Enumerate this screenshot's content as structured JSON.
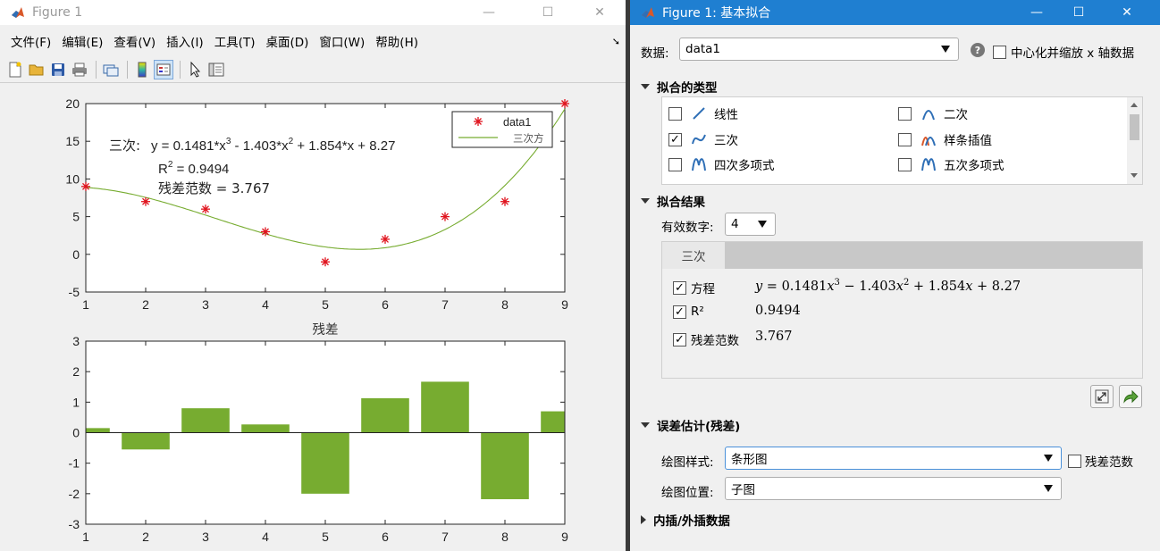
{
  "figure_window": {
    "title": "Figure 1",
    "menu": [
      "文件(F)",
      "编辑(E)",
      "查看(V)",
      "插入(I)",
      "工具(T)",
      "桌面(D)",
      "窗口(W)",
      "帮助(H)"
    ],
    "toolbar_icons": [
      "new-figure-icon",
      "open-icon",
      "save-icon",
      "print-icon",
      "link-icon",
      "colorbar-icon",
      "legend-icon",
      "pointer-icon",
      "property-editor-icon"
    ]
  },
  "fit_window": {
    "title": "Figure 1: 基本拟合",
    "data_label": "数据:",
    "data_value": "data1",
    "center_label": "中心化并缩放 x 轴数据",
    "section_fit_types": "拟合的类型",
    "fit_types": [
      {
        "label": "线性",
        "checked": false
      },
      {
        "label": "二次",
        "checked": false
      },
      {
        "label": "三次",
        "checked": true
      },
      {
        "label": "样条插值",
        "checked": false
      },
      {
        "label": "四次多项式",
        "checked": false
      },
      {
        "label": "五次多项式",
        "checked": false
      }
    ],
    "section_results": "拟合结果",
    "sig_digits_label": "有效数字:",
    "sig_digits_value": "4",
    "result_tab": "三次",
    "equation_label": "方程",
    "r2_label": "R²",
    "r2_value": "0.9494",
    "norm_label": "残差范数",
    "norm_value": "3.767",
    "section_error": "误差估计(残差)",
    "plot_style_label": "绘图样式:",
    "plot_style_value": "条形图",
    "resid_norm_check": "残差范数",
    "plot_location_label": "绘图位置:",
    "plot_location_value": "子图",
    "section_interp": "内插/外插数据"
  },
  "chart_data": [
    {
      "type": "scatter",
      "x": [
        1,
        2,
        3,
        4,
        5,
        6,
        7,
        8,
        9
      ],
      "y": [
        9,
        7,
        6,
        3,
        -1,
        2,
        5,
        7,
        20
      ],
      "xlim": [
        1,
        9
      ],
      "ylim": [
        -5,
        20
      ],
      "xticks": [
        1,
        2,
        3,
        4,
        5,
        6,
        7,
        8,
        9
      ],
      "yticks": [
        -5,
        0,
        5,
        10,
        15,
        20
      ],
      "fit": {
        "name": "三次方",
        "coefficients": [
          0.1481,
          -1.403,
          1.854,
          8.27
        ]
      },
      "legend": {
        "placement": "top-right",
        "entries": [
          "data1",
          "三次方"
        ]
      },
      "marker_color": "#e0141e",
      "fit_color": "#77ac30",
      "annotation": {
        "prefix": "三次:",
        "equation": "y = 0.1481*x³ - 1.403*x² + 1.854*x + 8.27",
        "r2": "R² = 0.9494",
        "norm": "残差范数 = 3.767"
      }
    },
    {
      "type": "bar",
      "title": "残差",
      "x": [
        1,
        2,
        3,
        4,
        5,
        6,
        7,
        8,
        9
      ],
      "values": [
        0.15,
        -0.55,
        0.8,
        0.27,
        -2.0,
        1.13,
        1.67,
        -2.18,
        0.7
      ],
      "xlim": [
        1,
        9
      ],
      "ylim": [
        -3,
        3
      ],
      "xticks": [
        1,
        2,
        3,
        4,
        5,
        6,
        7,
        8,
        9
      ],
      "yticks": [
        -3,
        -2,
        -1,
        0,
        1,
        2,
        3
      ],
      "bar_color": "#77ac30"
    }
  ]
}
